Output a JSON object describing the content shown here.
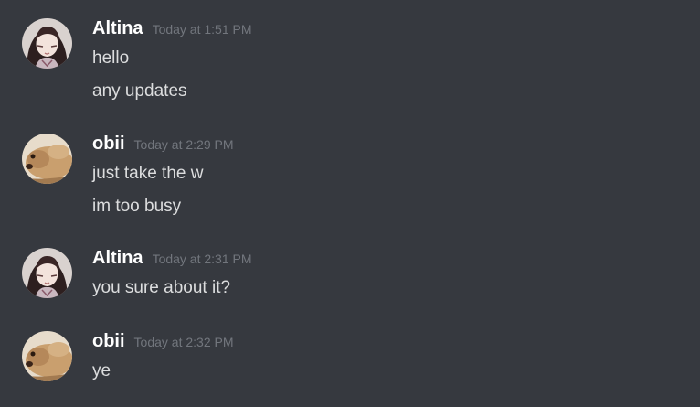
{
  "chat": {
    "groups": [
      {
        "username": "Altina",
        "timestamp": "Today at 1:51 PM",
        "avatar": "anime-girl-avatar",
        "messages": [
          "hello",
          "any updates"
        ]
      },
      {
        "username": "obii",
        "timestamp": "Today at 2:29 PM",
        "avatar": "dog-avatar",
        "messages": [
          "just take the w",
          "im too busy"
        ]
      },
      {
        "username": "Altina",
        "timestamp": "Today at 2:31 PM",
        "avatar": "anime-girl-avatar",
        "messages": [
          "you sure about it?"
        ]
      },
      {
        "username": "obii",
        "timestamp": "Today at 2:32 PM",
        "avatar": "dog-avatar",
        "messages": [
          "ye"
        ]
      }
    ]
  },
  "colors": {
    "background": "#36393f",
    "username": "#ffffff",
    "timestamp": "#72767d",
    "message_text": "#dcddde"
  }
}
